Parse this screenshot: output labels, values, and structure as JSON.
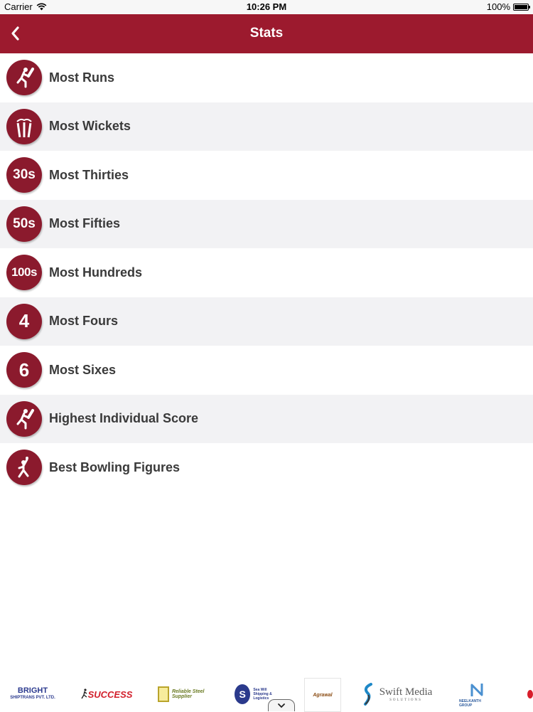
{
  "status_bar": {
    "carrier": "Carrier",
    "time": "10:26 PM",
    "battery": "100%",
    "battery_level": 1.0
  },
  "nav": {
    "title": "Stats",
    "back_icon": "chevron-left-icon"
  },
  "stats": [
    {
      "label": "Most Runs",
      "icon": "batsman-icon",
      "badge": ""
    },
    {
      "label": "Most Wickets",
      "icon": "wickets-icon",
      "badge": ""
    },
    {
      "label": "Most Thirties",
      "icon": "badge-30s-icon",
      "badge": "30s"
    },
    {
      "label": "Most Fifties",
      "icon": "badge-50s-icon",
      "badge": "50s"
    },
    {
      "label": "Most Hundreds",
      "icon": "badge-100s-icon",
      "badge": "100s"
    },
    {
      "label": "Most Fours",
      "icon": "badge-4-icon",
      "badge": "4"
    },
    {
      "label": "Most Sixes",
      "icon": "badge-6-icon",
      "badge": "6"
    },
    {
      "label": "Highest Individual Score",
      "icon": "batsman-icon",
      "badge": ""
    },
    {
      "label": "Best Bowling Figures",
      "icon": "bowler-icon",
      "badge": ""
    }
  ],
  "sponsors": {
    "bright": {
      "name": "BRIGHT",
      "sub": "SHIPTRANS PVT. LTD."
    },
    "success": {
      "name": "SUCCESS"
    },
    "reliable": {
      "name": "Reliable Steel Supplier"
    },
    "seawill": {
      "initial": "S",
      "name": "Sea Will",
      "sub": "Shipping & Logistics"
    },
    "agrawal": {
      "name": "Agrawal"
    },
    "swift": {
      "name": "Swift Media",
      "sub": "SOLUTIONS"
    },
    "neelkanth": {
      "name": "NEELKANTH GROUP"
    }
  },
  "colors": {
    "primary": "#9c1a2e",
    "badge": "#8b1a2d",
    "row_alt": "#f2f2f4"
  }
}
